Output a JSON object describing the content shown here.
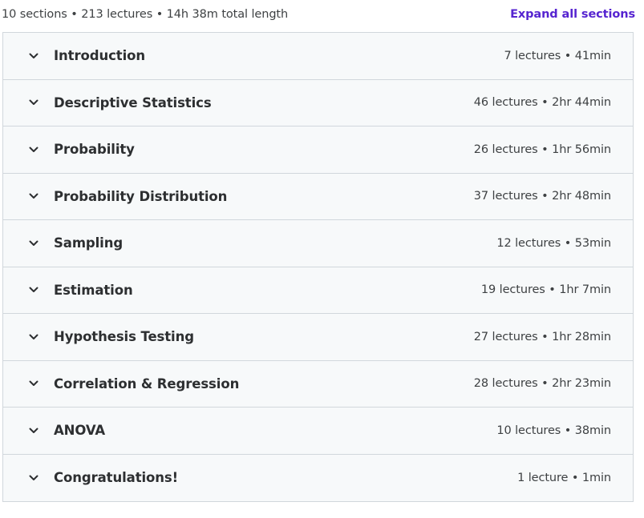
{
  "summary": {
    "text": "10 sections • 213 lectures • 14h 38m total length",
    "expand_all_label": "Expand all sections"
  },
  "sections": [
    {
      "title": "Introduction",
      "meta": "7 lectures • 41min"
    },
    {
      "title": "Descriptive Statistics",
      "meta": "46 lectures • 2hr 44min"
    },
    {
      "title": "Probability",
      "meta": "26 lectures • 1hr 56min"
    },
    {
      "title": "Probability Distribution",
      "meta": "37 lectures • 2hr 48min"
    },
    {
      "title": "Sampling",
      "meta": "12 lectures • 53min"
    },
    {
      "title": "Estimation",
      "meta": "19 lectures • 1hr 7min"
    },
    {
      "title": "Hypothesis Testing",
      "meta": "27 lectures • 1hr 28min"
    },
    {
      "title": "Correlation & Regression",
      "meta": "28 lectures • 2hr 23min"
    },
    {
      "title": "ANOVA",
      "meta": "10 lectures • 38min"
    },
    {
      "title": "Congratulations!",
      "meta": "1 lecture • 1min"
    }
  ],
  "icons": {
    "chevron": "chevron-down-icon"
  },
  "colors": {
    "accent": "#5624d0",
    "row_background": "#f7f9fa",
    "border": "#d1d7dc",
    "text": "#2d2f31"
  }
}
